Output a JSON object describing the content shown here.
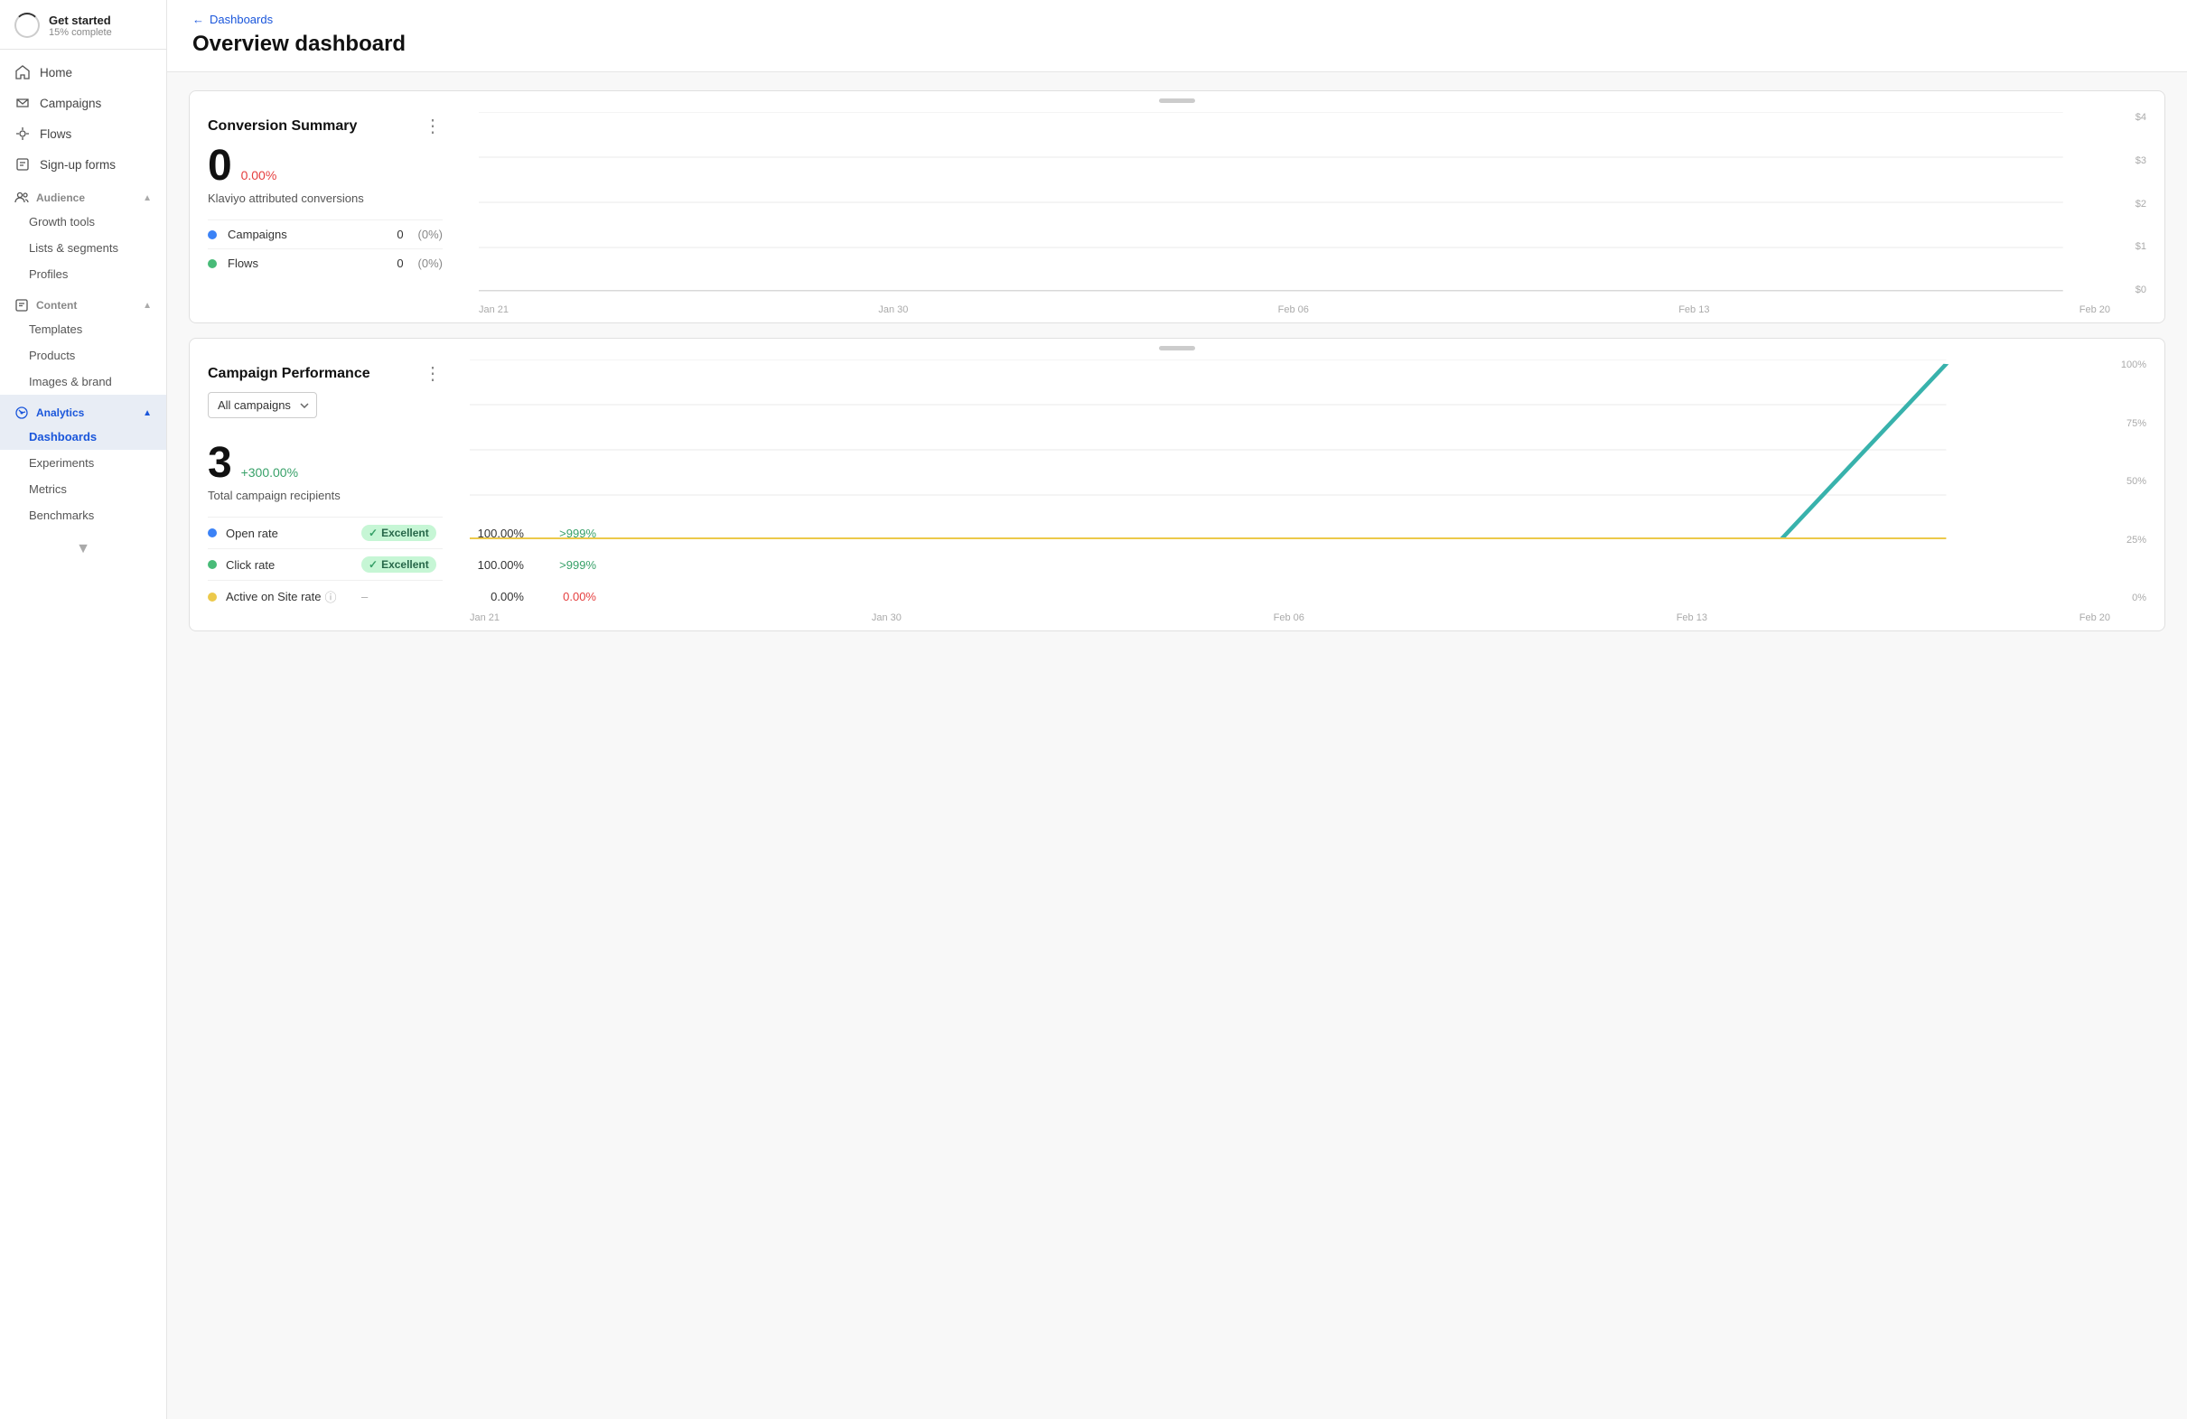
{
  "sidebar": {
    "get_started": {
      "title": "Get started",
      "subtitle": "15% complete"
    },
    "nav_items": [
      {
        "id": "home",
        "label": "Home",
        "icon": "home"
      },
      {
        "id": "campaigns",
        "label": "Campaigns",
        "icon": "campaigns"
      },
      {
        "id": "flows",
        "label": "Flows",
        "icon": "flows"
      },
      {
        "id": "signup-forms",
        "label": "Sign-up forms",
        "icon": "forms"
      }
    ],
    "audience_section": {
      "label": "Audience",
      "items": [
        {
          "id": "growth-tools",
          "label": "Growth tools"
        },
        {
          "id": "lists-segments",
          "label": "Lists & segments"
        },
        {
          "id": "profiles",
          "label": "Profiles"
        }
      ]
    },
    "content_section": {
      "label": "Content",
      "items": [
        {
          "id": "templates",
          "label": "Templates"
        },
        {
          "id": "products",
          "label": "Products"
        },
        {
          "id": "images-brand",
          "label": "Images & brand"
        }
      ]
    },
    "analytics_section": {
      "label": "Analytics",
      "items": [
        {
          "id": "dashboards",
          "label": "Dashboards",
          "active": true
        },
        {
          "id": "experiments",
          "label": "Experiments"
        },
        {
          "id": "metrics",
          "label": "Metrics"
        },
        {
          "id": "benchmarks",
          "label": "Benchmarks"
        }
      ]
    }
  },
  "header": {
    "breadcrumb_label": "Dashboards",
    "page_title": "Overview dashboard"
  },
  "conversion_summary": {
    "title": "Conversion Summary",
    "big_number": "0",
    "pct_change": "0.00%",
    "attributed_label": "Klaviyo attributed conversions",
    "metrics": [
      {
        "color": "blue",
        "name": "Campaigns",
        "value": "0",
        "pct": "(0%)"
      },
      {
        "color": "green",
        "name": "Flows",
        "value": "0",
        "pct": "(0%)"
      }
    ],
    "chart": {
      "y_labels": [
        "$4",
        "$3",
        "$2",
        "$1",
        "$0"
      ],
      "x_labels": [
        "Jan 21",
        "Jan 30",
        "Feb 06",
        "Feb 13",
        "Feb 20"
      ]
    }
  },
  "campaign_performance": {
    "title": "Campaign Performance",
    "dropdown_label": "All campaigns",
    "big_number": "3",
    "pct_change": "+300.00%",
    "total_label": "Total campaign recipients",
    "metrics": [
      {
        "color": "blue",
        "name": "Open rate",
        "badge": "Excellent",
        "value": "100.00%",
        "change": ">999%",
        "change_color": "green"
      },
      {
        "color": "green",
        "name": "Click rate",
        "badge": "Excellent",
        "value": "100.00%",
        "change": ">999%",
        "change_color": "green"
      },
      {
        "color": "yellow",
        "name": "Active on Site rate",
        "badge": null,
        "value": "0.00%",
        "change": "0.00%",
        "change_color": "red",
        "has_info": true
      }
    ],
    "chart": {
      "y_labels": [
        "100%",
        "75%",
        "50%",
        "25%",
        "0%"
      ],
      "x_labels": [
        "Jan 21",
        "Jan 30",
        "Feb 06",
        "Feb 13",
        "Feb 20"
      ]
    }
  }
}
